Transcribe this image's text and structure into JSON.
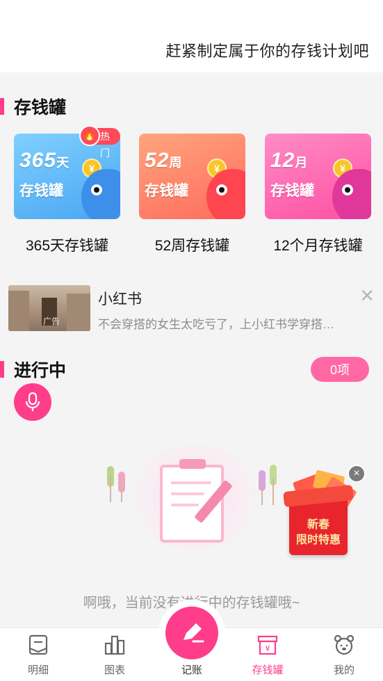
{
  "header": {
    "slogan": "赶紧制定属于你的存钱计划吧"
  },
  "piggy_section": {
    "title": "存钱罐",
    "jars": [
      {
        "big": "365",
        "unit": "天",
        "sub": "存钱罐",
        "name": "365天存钱罐",
        "badge": "热门",
        "colors": {
          "card": "#5cb6f5",
          "fish": "#3d8fea"
        }
      },
      {
        "big": "52",
        "unit": "周",
        "sub": "存钱罐",
        "name": "52周存钱罐",
        "colors": {
          "card": "#ff8a6a",
          "fish": "#ff4a50"
        }
      },
      {
        "big": "12",
        "unit": "月",
        "sub": "存钱罐",
        "name": "12个月存钱罐",
        "colors": {
          "card": "#ff6fb2",
          "fish": "#e0389a"
        }
      }
    ],
    "coin_symbol": "¥"
  },
  "ad": {
    "title": "小红书",
    "description": "不会穿搭的女生太吃亏了，上小红书学穿搭…",
    "ad_label": "广告",
    "close_icon": "close-icon"
  },
  "in_progress": {
    "title": "进行中",
    "count_label": "0项",
    "empty_text": "啊哦，当前没有进行中的存钱罐哦~"
  },
  "promo": {
    "line1": "新春",
    "line2": "限时特惠",
    "close_symbol": "×"
  },
  "tabbar": {
    "tabs": [
      {
        "label": "明细",
        "icon": "ledger-icon"
      },
      {
        "label": "图表",
        "icon": "chart-icon"
      },
      {
        "label": "记账",
        "icon": "pen-icon"
      },
      {
        "label": "存钱罐",
        "icon": "piggy-box-icon",
        "active": true
      },
      {
        "label": "我的",
        "icon": "bear-icon"
      }
    ]
  },
  "colors": {
    "accent": "#ff3d8b",
    "pill": "#ff68a4"
  }
}
